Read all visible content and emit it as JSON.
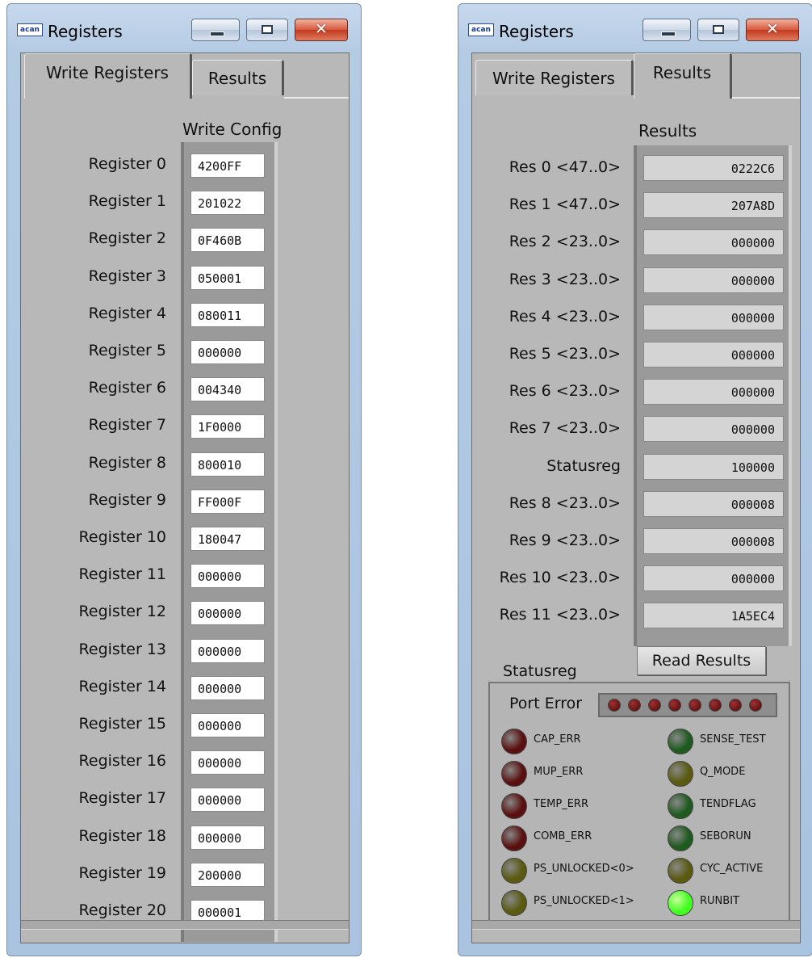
{
  "left_window": {
    "title": "Registers",
    "app_icon": "acan",
    "tabs": [
      "Write Registers",
      "Results"
    ],
    "section_title": "Write Config",
    "registers": [
      {
        "label": "Register 0",
        "value": "4200FF"
      },
      {
        "label": "Register 1",
        "value": "201022"
      },
      {
        "label": "Register 2",
        "value": "0F460B"
      },
      {
        "label": "Register 3",
        "value": "050001"
      },
      {
        "label": "Register 4",
        "value": "080011"
      },
      {
        "label": "Register 5",
        "value": "000000"
      },
      {
        "label": "Register 6",
        "value": "004340"
      },
      {
        "label": "Register 7",
        "value": "1F0000"
      },
      {
        "label": "Register 8",
        "value": "800010"
      },
      {
        "label": "Register 9",
        "value": "FF000F"
      },
      {
        "label": "Register 10",
        "value": "180047"
      },
      {
        "label": "Register 11",
        "value": "000000"
      },
      {
        "label": "Register 12",
        "value": "000000"
      },
      {
        "label": "Register 13",
        "value": "000000"
      },
      {
        "label": "Register 14",
        "value": "000000"
      },
      {
        "label": "Register 15",
        "value": "000000"
      },
      {
        "label": "Register 16",
        "value": "000000"
      },
      {
        "label": "Register 17",
        "value": "000000"
      },
      {
        "label": "Register 18",
        "value": "000000"
      },
      {
        "label": "Register 19",
        "value": "200000"
      },
      {
        "label": "Register 20",
        "value": "000001"
      }
    ]
  },
  "right_window": {
    "title": "Registers",
    "app_icon": "acan",
    "tabs": [
      "Write Registers",
      "Results"
    ],
    "section_title": "Results",
    "results": [
      {
        "label": "Res 0 <47..0>",
        "value": "0222C6"
      },
      {
        "label": "Res 1 <47..0>",
        "value": "207A8D"
      },
      {
        "label": "Res 2 <23..0>",
        "value": "000000"
      },
      {
        "label": "Res 3 <23..0>",
        "value": "000000"
      },
      {
        "label": "Res 4 <23..0>",
        "value": "000000"
      },
      {
        "label": "Res 5 <23..0>",
        "value": "000000"
      },
      {
        "label": "Res 6 <23..0>",
        "value": "000000"
      },
      {
        "label": "Res 7 <23..0>",
        "value": "000000"
      },
      {
        "label": "Statusreg",
        "value": "100000"
      },
      {
        "label": "Res 8 <23..0>",
        "value": "000008"
      },
      {
        "label": "Res 9 <23..0>",
        "value": "000008"
      },
      {
        "label": "Res 10 <23..0>",
        "value": "000000"
      },
      {
        "label": "Res 11 <23..0>",
        "value": "1A5EC4"
      }
    ],
    "read_button": "Read Results",
    "statusreg_label": "Statusreg",
    "port_error_label": "Port Error",
    "port_error_leds": 8,
    "flags_left": [
      {
        "label": "CAP_ERR",
        "state": "off",
        "color": "#5a1010"
      },
      {
        "label": "MUP_ERR",
        "state": "off",
        "color": "#5a1010"
      },
      {
        "label": "TEMP_ERR",
        "state": "off",
        "color": "#5a1010"
      },
      {
        "label": "COMB_ERR",
        "state": "off",
        "color": "#5a1010"
      },
      {
        "label": "PS_UNLOCKED<0>",
        "state": "off",
        "color": "#5a5a10"
      },
      {
        "label": "PS_UNLOCKED<1>",
        "state": "off",
        "color": "#5a5a10"
      }
    ],
    "flags_right": [
      {
        "label": "SENSE_TEST",
        "state": "off",
        "color": "#1f5a1f"
      },
      {
        "label": "Q_MODE",
        "state": "off",
        "color": "#5a5a10"
      },
      {
        "label": "TENDFLAG",
        "state": "off",
        "color": "#1f5a1f"
      },
      {
        "label": "SEBORUN",
        "state": "off",
        "color": "#1f5a1f"
      },
      {
        "label": "CYC_ACTIVE",
        "state": "off",
        "color": "#5a5a10"
      },
      {
        "label": "RUNBIT",
        "state": "on",
        "color": "#44ff22"
      }
    ]
  }
}
